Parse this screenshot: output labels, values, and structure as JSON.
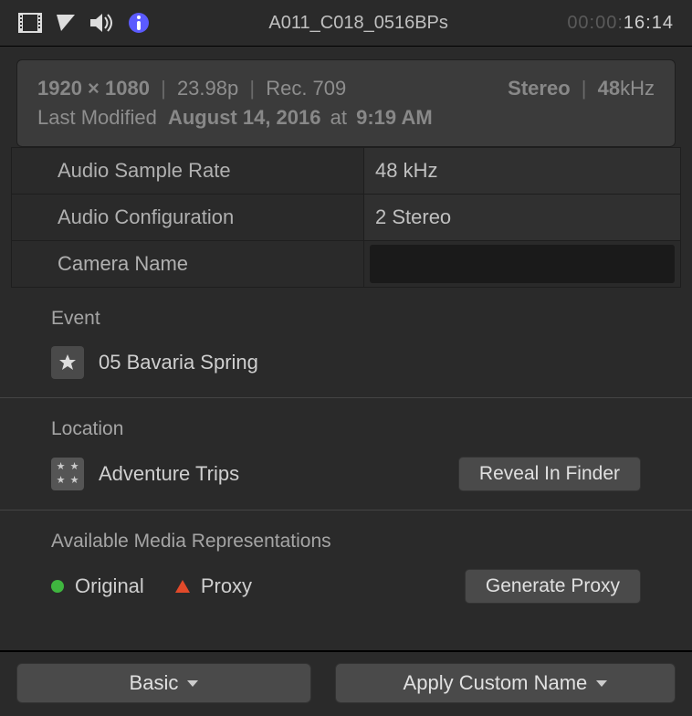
{
  "header": {
    "title": "A011_C018_0516BPs",
    "timecode_dim": "00:00:",
    "timecode_bright": "16:14"
  },
  "summary": {
    "resolution": "1920 × 1080",
    "frame_rate": "23.98p",
    "color_space": "Rec. 709",
    "audio_mode": "Stereo",
    "audio_rate_display": "48",
    "audio_rate_unit": "kHz",
    "modified_prefix": "Last Modified",
    "modified_date": "August 14, 2016",
    "modified_at": "at",
    "modified_time": "9:19 AM"
  },
  "props": {
    "audio_sample_rate_label": "Audio Sample Rate",
    "audio_sample_rate_value": "48 kHz",
    "audio_config_label": "Audio Configuration",
    "audio_config_value": "2 Stereo",
    "camera_name_label": "Camera Name",
    "camera_name_value": ""
  },
  "event": {
    "label": "Event",
    "name": "05 Bavaria Spring"
  },
  "location": {
    "label": "Location",
    "name": "Adventure Trips",
    "reveal_btn": "Reveal In Finder"
  },
  "media": {
    "label": "Available Media Representations",
    "original_label": "Original",
    "original_status_color": "#3fb63f",
    "proxy_label": "Proxy",
    "proxy_status_color": "#e24a2a",
    "generate_btn": "Generate Proxy"
  },
  "footer": {
    "metadata_view": "Basic",
    "action_menu": "Apply Custom Name"
  }
}
